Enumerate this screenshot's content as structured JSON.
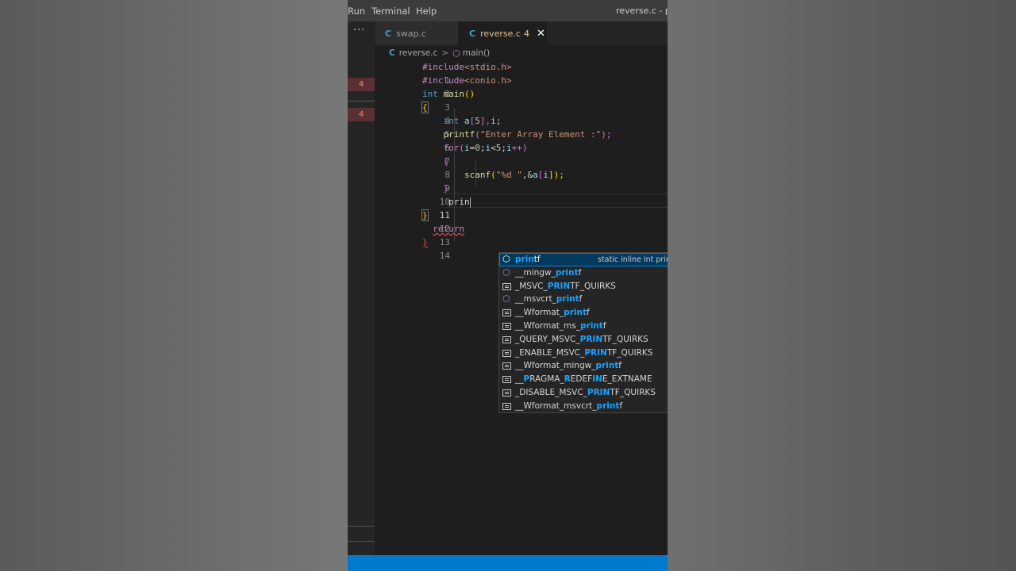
{
  "menubar": {
    "items": [
      "Run",
      "Terminal",
      "Help"
    ],
    "window_title": "reverse.c - poi"
  },
  "tabs": [
    {
      "icon": "C",
      "label": "swap.c",
      "active": false
    },
    {
      "icon": "C",
      "label": "reverse.c",
      "badge": "4",
      "active": true
    }
  ],
  "sidebar": {
    "more_label": "···",
    "badges": [
      "4",
      "4"
    ]
  },
  "breadcrumb": {
    "file_icon": "C",
    "file": "reverse.c",
    "separator": ">",
    "symbol": "main()"
  },
  "code_lines": [
    {
      "n": "1"
    },
    {
      "n": "2"
    },
    {
      "n": "3"
    },
    {
      "n": "4"
    },
    {
      "n": "5"
    },
    {
      "n": "6"
    },
    {
      "n": "7"
    },
    {
      "n": "8"
    },
    {
      "n": "9"
    },
    {
      "n": "10"
    },
    {
      "n": "11"
    },
    {
      "n": "12"
    },
    {
      "n": "13"
    },
    {
      "n": "14"
    }
  ],
  "code": {
    "l1": {
      "a": "#include",
      "b": "<stdio.h>"
    },
    "l2": {
      "a": "#include",
      "b": "<conio.h>"
    },
    "l3": {
      "a": "int",
      "b": "main",
      "c": "()"
    },
    "l4": {
      "a": "{"
    },
    "l5": {
      "a": "int",
      "b": "a",
      "c": "[",
      "d": "5",
      "e": "],",
      "f": "i",
      "g": ";"
    },
    "l6": {
      "a": "printf",
      "b": "(",
      "c": "\"Enter Array Element :\"",
      "d": ");"
    },
    "l7": {
      "a": "for",
      "b": "(",
      "c": "i",
      "d": "=",
      "e": "0",
      "f": ";",
      "g": "i",
      "h": "<",
      "i": "5",
      "j": ";",
      "k": "i",
      "l": "++)"
    },
    "l8": {
      "a": "{"
    },
    "l9": {
      "a": "scanf",
      "b": "(",
      "c": "\"%d \"",
      "d": ",&",
      "e": "a",
      "f": "[",
      "g": "i",
      "h": "]);"
    },
    "l10": {
      "a": "}"
    },
    "l11": {
      "a": "prin"
    },
    "l12": {
      "a": "}"
    },
    "l13": {
      "a": "return"
    },
    "l14": {
      "a": "}"
    }
  },
  "suggestions": [
    {
      "icon": "function-icon",
      "pre": "",
      "hl": "prin",
      "mid": "tf",
      "hl2": "",
      "post": "",
      "detail": "static inline int prin",
      "selected": true
    },
    {
      "icon": "function-icon",
      "pre": "__mingw_",
      "hl": "print",
      "mid": "f",
      "hl2": "",
      "post": "",
      "detail": ""
    },
    {
      "icon": "text-icon",
      "pre": "_MSVC_",
      "hl": "PRIN",
      "mid": "TF_QUIRKS",
      "hl2": "",
      "post": "",
      "detail": ""
    },
    {
      "icon": "function-icon",
      "pre": "__msvcrt_",
      "hl": "print",
      "mid": "f",
      "hl2": "",
      "post": "",
      "detail": ""
    },
    {
      "icon": "text-icon",
      "pre": "__Wformat_",
      "hl": "print",
      "mid": "f",
      "hl2": "",
      "post": "",
      "detail": ""
    },
    {
      "icon": "text-icon",
      "pre": "__Wformat_ms_",
      "hl": "print",
      "mid": "f",
      "hl2": "",
      "post": "",
      "detail": ""
    },
    {
      "icon": "text-icon",
      "pre": "_QUERY_MSVC_",
      "hl": "PRIN",
      "mid": "TF_QUIRKS",
      "hl2": "",
      "post": "",
      "detail": ""
    },
    {
      "icon": "text-icon",
      "pre": "_ENABLE_MSVC_",
      "hl": "PRIN",
      "mid": "TF_QUIRKS",
      "hl2": "",
      "post": "",
      "detail": ""
    },
    {
      "icon": "text-icon",
      "pre": "__Wformat_mingw_",
      "hl": "print",
      "mid": "f",
      "hl2": "",
      "post": "",
      "detail": ""
    },
    {
      "icon": "text-icon",
      "pre": "__",
      "hl": "P",
      "mid": "RAGMA_",
      "hl2": "R",
      "post": "EDEF",
      "hl3": "IN",
      "post2": "E_EXTNAME",
      "detail": ""
    },
    {
      "icon": "text-icon",
      "pre": "_DISABLE_MSVC_",
      "hl": "PRIN",
      "mid": "TF_QUIRKS",
      "hl2": "",
      "post": "",
      "detail": ""
    },
    {
      "icon": "text-icon",
      "pre": "__Wformat_msvcrt_",
      "hl": "print",
      "mid": "f",
      "hl2": "",
      "post": "",
      "detail": ""
    }
  ]
}
